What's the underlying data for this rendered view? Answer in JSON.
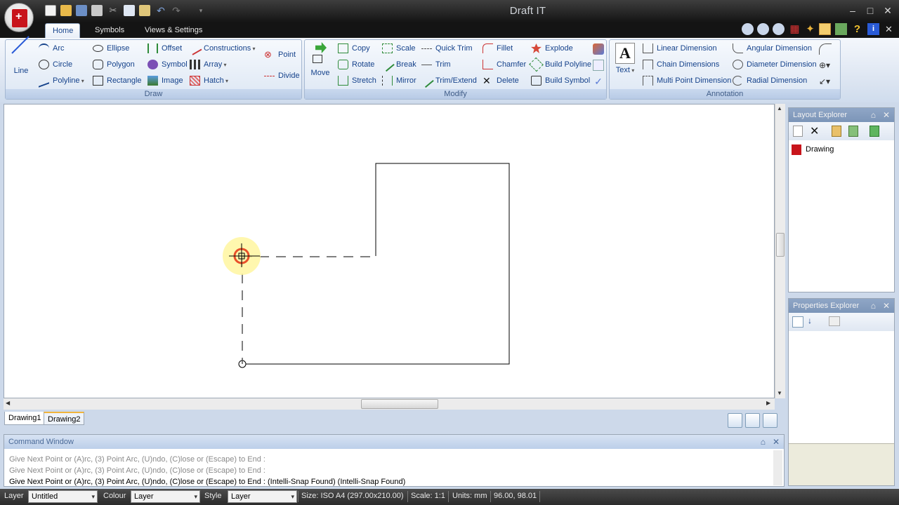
{
  "window": {
    "title": "Draft IT"
  },
  "tabs": [
    "Home",
    "Symbols",
    "Views & Settings"
  ],
  "draw_group": {
    "label": "Draw",
    "line": "Line",
    "col1": [
      "Arc",
      "Circle",
      "Polyline"
    ],
    "col2": [
      "Ellipse",
      "Polygon",
      "Rectangle"
    ],
    "col3": [
      "Offset",
      "Symbol",
      "Image"
    ],
    "col4": [
      "Constructions",
      "Array",
      "Hatch"
    ],
    "col5": [
      "Point",
      "Divide"
    ]
  },
  "modify_group": {
    "label": "Modify",
    "move": "Move",
    "col1": [
      "Copy",
      "Rotate",
      "Stretch"
    ],
    "col2": [
      "Scale",
      "Break",
      "Mirror"
    ],
    "col3": [
      "Quick Trim",
      "Trim",
      "Trim/Extend"
    ],
    "col4": [
      "Fillet",
      "Chamfer",
      "Delete"
    ],
    "col5": [
      "Explode",
      "Build Polyline",
      "Build Symbol"
    ]
  },
  "annotation_group": {
    "label": "Annotation",
    "text": "Text",
    "col1": [
      "Linear Dimension",
      "Chain Dimensions",
      "Multi Point Dimension"
    ],
    "col2": [
      "Angular Dimension",
      "Diameter Dimension",
      "Radial Dimension"
    ]
  },
  "drawing_tabs": [
    "Drawing1",
    "Drawing2"
  ],
  "command_window": {
    "title": "Command Window",
    "lines": [
      "Give Next Point or (A)rc, (3) Point Arc, (U)ndo, (C)lose or (Escape) to End :",
      "Give Next Point or (A)rc, (3) Point Arc, (U)ndo, (C)lose or (Escape) to End :",
      "Give Next Point or (A)rc, (3) Point Arc, (U)ndo, (C)lose or (Escape) to End :  (Intelli-Snap Found) (Intelli-Snap Found)"
    ]
  },
  "layout_explorer": {
    "title": "Layout Explorer",
    "item": "Drawing"
  },
  "properties_explorer": {
    "title": "Properties Explorer"
  },
  "status": {
    "layer_label": "Layer",
    "layer_value": "Untitled",
    "colour_label": "Colour",
    "colour_value": "Layer",
    "style_label": "Style",
    "style_value": "Layer",
    "size": "Size: ISO A4 (297.00x210.00)",
    "scale": "Scale: 1:1",
    "units": "Units: mm",
    "coords": "96.00, 98.01"
  },
  "colors": {
    "accent": "#15428b",
    "title_bg": "#1e1e1e",
    "app_red": "#c8141b"
  }
}
